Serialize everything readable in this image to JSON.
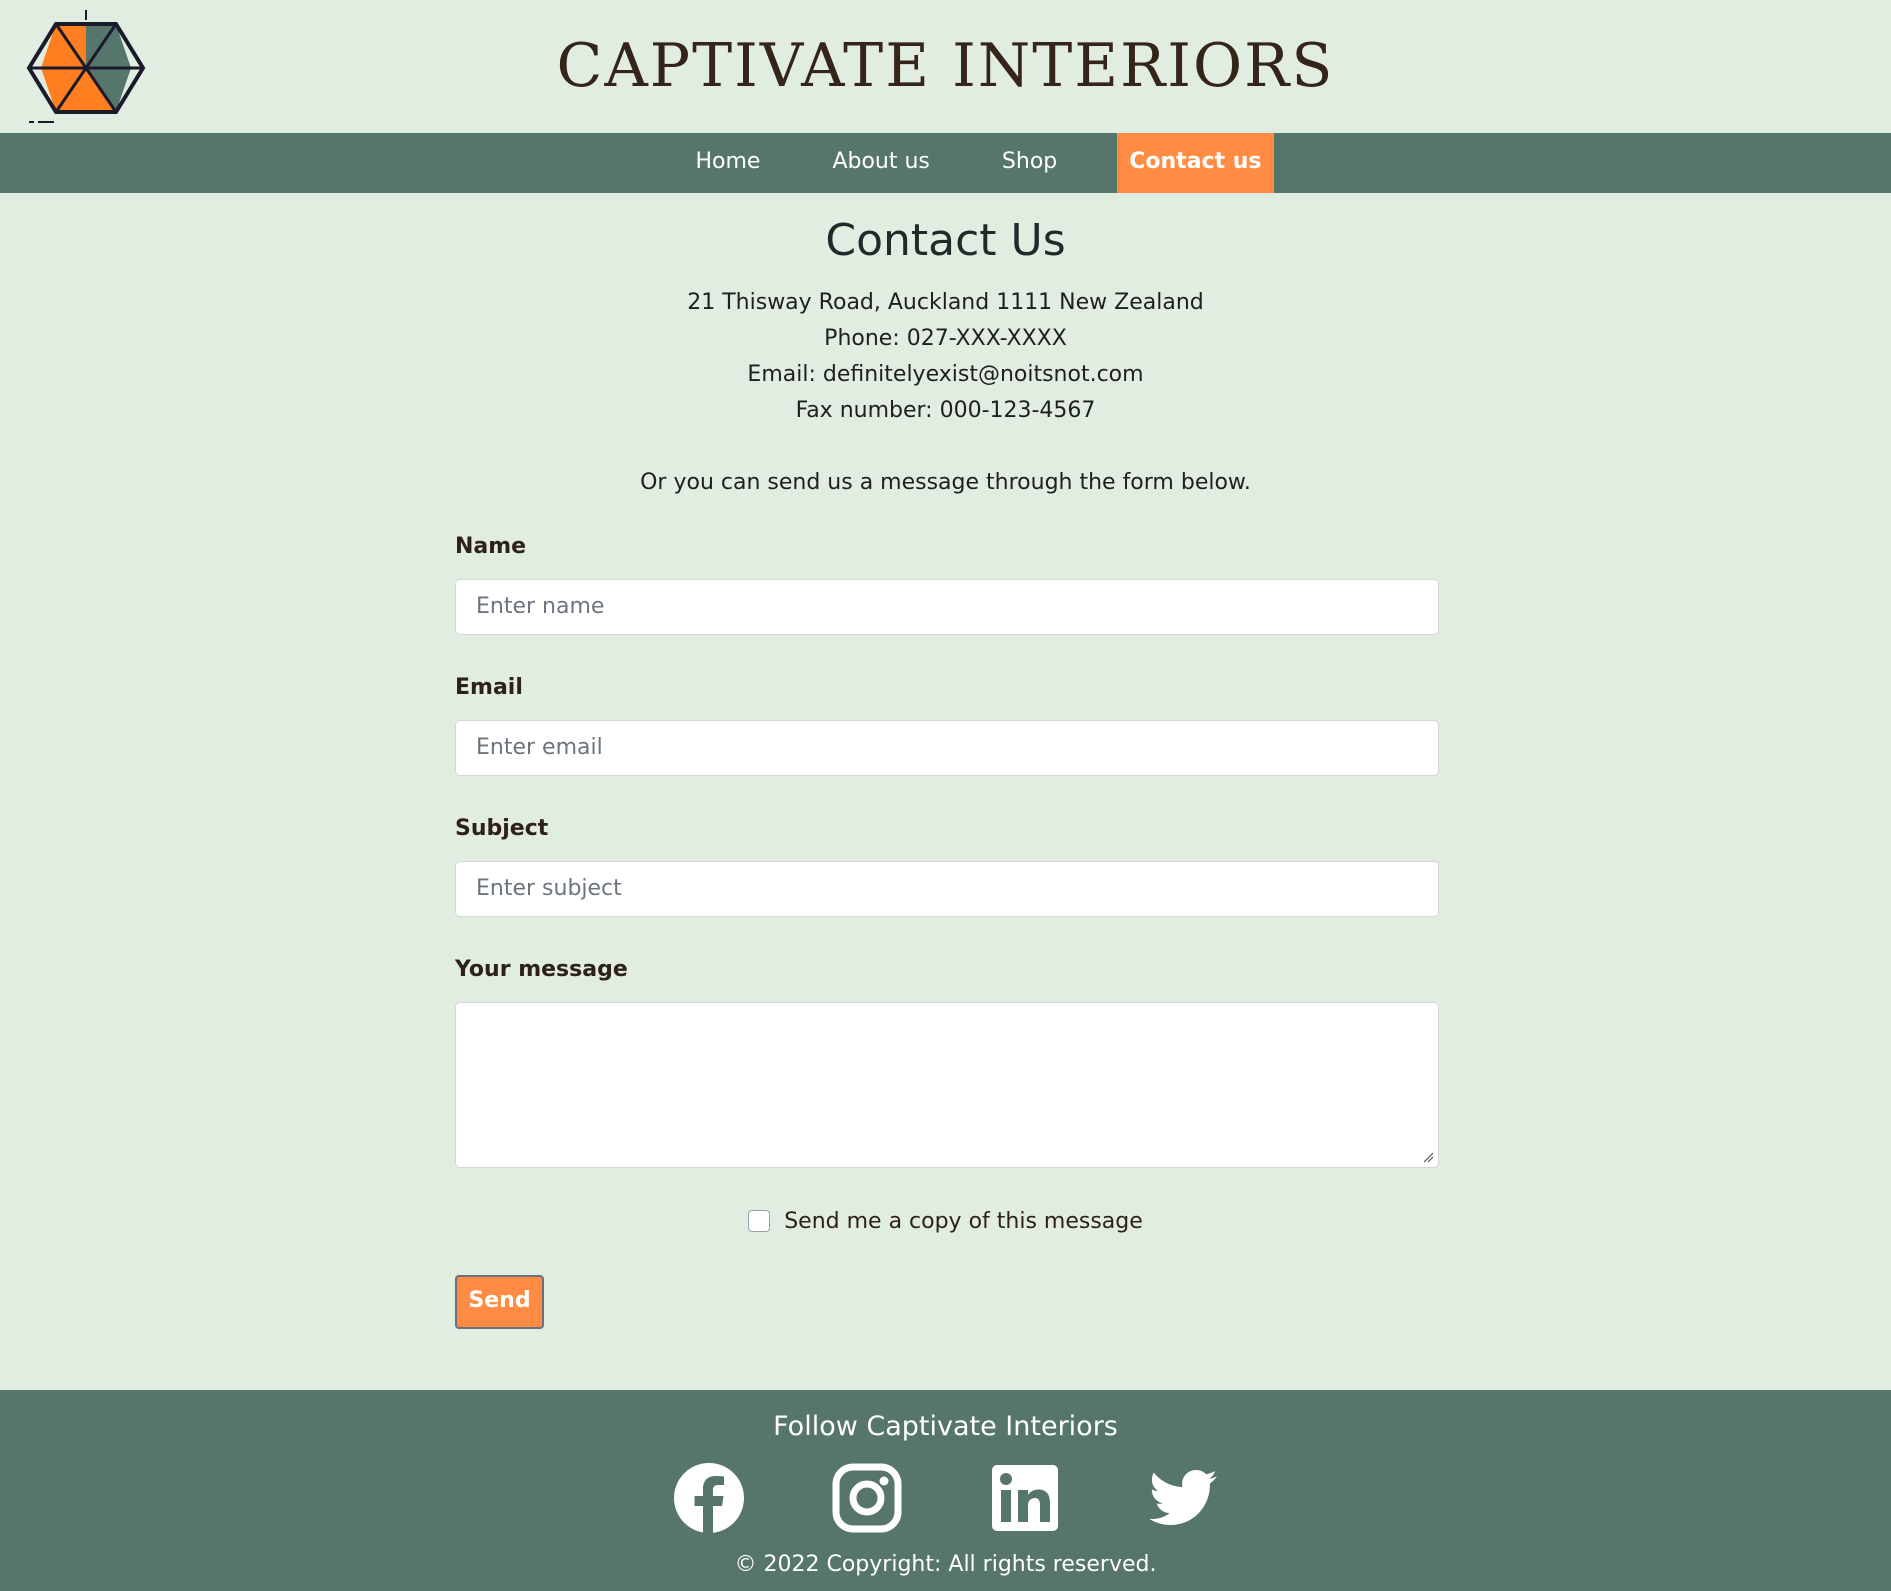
{
  "brand": {
    "title": "CAPTIVATE INTERIORS",
    "logo_icon": "hexagon-logo-icon"
  },
  "nav": {
    "items": [
      {
        "label": "Home"
      },
      {
        "label": "About us"
      },
      {
        "label": "Shop"
      },
      {
        "label": "Contact us",
        "active": true
      }
    ]
  },
  "contact": {
    "title": "Contact Us",
    "address": "21 Thisway Road, Auckland 1111 New Zealand",
    "phone": "Phone: 027-XXX-XXXX",
    "email": "Email: definitelyexist@noitsnot.com",
    "fax": "Fax number: 000-123-4567",
    "form_intro": "Or you can send us a message through the form below."
  },
  "form": {
    "name_label": "Name",
    "name_placeholder": "Enter name",
    "email_label": "Email",
    "email_placeholder": "Enter email",
    "subject_label": "Subject",
    "subject_placeholder": "Enter subject",
    "message_label": "Your message",
    "copy_label": "Send me a copy of this message",
    "send_label": "Send"
  },
  "footer": {
    "title": "Follow Captivate Interiors",
    "copyright": "© 2022 Copyright: All rights reserved.",
    "social_icons": [
      "facebook-icon",
      "instagram-icon",
      "linkedin-icon",
      "twitter-icon"
    ]
  },
  "colors": {
    "background": "#e2ede1",
    "nav_bg": "#56756b",
    "accent": "#ff8c42",
    "title_text": "#35241a"
  }
}
